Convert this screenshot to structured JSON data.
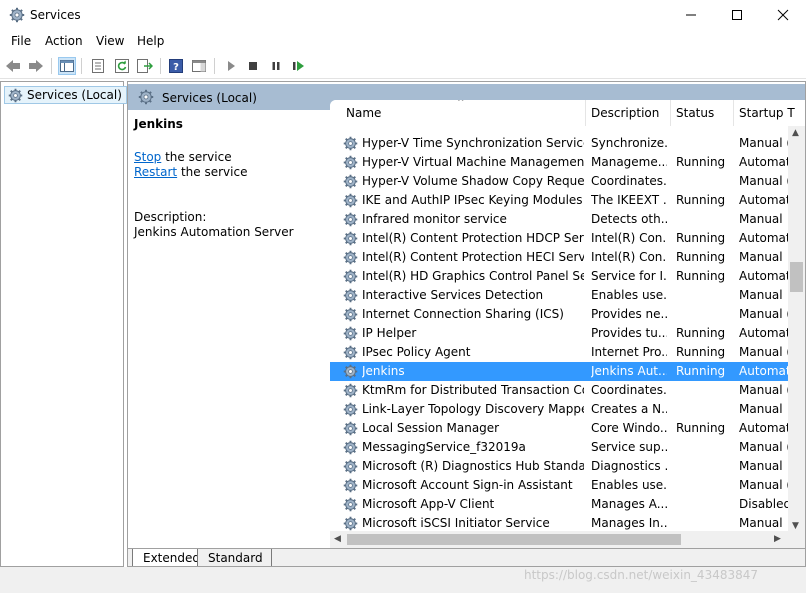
{
  "window": {
    "title": "Services"
  },
  "menu": [
    "File",
    "Action",
    "View",
    "Help"
  ],
  "tree": {
    "root_label": "Services (Local)"
  },
  "header": {
    "label": "Services (Local)"
  },
  "detail": {
    "service_name": "Jenkins",
    "stop_link": "Stop",
    "stop_rest": " the service",
    "restart_link": "Restart",
    "restart_rest": " the service",
    "description_label": "Description:",
    "description_text": "Jenkins Automation Server"
  },
  "columns": {
    "name": "Name",
    "description": "Description",
    "status": "Status",
    "startup": "Startup T"
  },
  "services": [
    {
      "name": "Hyper-V Time Synchronization Service",
      "description": "Synchronize...",
      "status": "",
      "startup": "Manual ("
    },
    {
      "name": "Hyper-V Virtual Machine Management",
      "description": "Manageme...",
      "status": "Running",
      "startup": "Automat"
    },
    {
      "name": "Hyper-V Volume Shadow Copy Requestor",
      "description": "Coordinates...",
      "status": "",
      "startup": "Manual ("
    },
    {
      "name": "IKE and AuthIP IPsec Keying Modules",
      "description": "The IKEEXT ...",
      "status": "Running",
      "startup": "Automat"
    },
    {
      "name": "Infrared monitor service",
      "description": "Detects oth...",
      "status": "",
      "startup": "Manual"
    },
    {
      "name": "Intel(R) Content Protection HDCP Service",
      "description": "Intel(R) Con...",
      "status": "Running",
      "startup": "Automat"
    },
    {
      "name": "Intel(R) Content Protection HECI Service",
      "description": "Intel(R) Con...",
      "status": "Running",
      "startup": "Manual"
    },
    {
      "name": "Intel(R) HD Graphics Control Panel Servi...",
      "description": "Service for I...",
      "status": "Running",
      "startup": "Automat"
    },
    {
      "name": "Interactive Services Detection",
      "description": "Enables use...",
      "status": "",
      "startup": "Manual"
    },
    {
      "name": "Internet Connection Sharing (ICS)",
      "description": "Provides ne...",
      "status": "",
      "startup": "Manual ("
    },
    {
      "name": "IP Helper",
      "description": "Provides tu...",
      "status": "Running",
      "startup": "Automat"
    },
    {
      "name": "IPsec Policy Agent",
      "description": "Internet Pro...",
      "status": "Running",
      "startup": "Manual ("
    },
    {
      "name": "Jenkins",
      "description": "Jenkins Aut...",
      "status": "Running",
      "startup": "Automat",
      "selected": true
    },
    {
      "name": "KtmRm for Distributed Transaction Coor...",
      "description": "Coordinates...",
      "status": "",
      "startup": "Manual ("
    },
    {
      "name": "Link-Layer Topology Discovery Mapper",
      "description": "Creates a N...",
      "status": "",
      "startup": "Manual"
    },
    {
      "name": "Local Session Manager",
      "description": "Core Windo...",
      "status": "Running",
      "startup": "Automat"
    },
    {
      "name": "MessagingService_f32019a",
      "description": "Service sup...",
      "status": "",
      "startup": "Manual ("
    },
    {
      "name": "Microsoft (R) Diagnostics Hub Standard ...",
      "description": "Diagnostics ...",
      "status": "",
      "startup": "Manual"
    },
    {
      "name": "Microsoft Account Sign-in Assistant",
      "description": "Enables use...",
      "status": "",
      "startup": "Manual ("
    },
    {
      "name": "Microsoft App-V Client",
      "description": "Manages A...",
      "status": "",
      "startup": "Disabled"
    },
    {
      "name": "Microsoft iSCSI Initiator Service",
      "description": "Manages In...",
      "status": "",
      "startup": "Manual"
    }
  ],
  "tabs": [
    "Extended",
    "Standard"
  ],
  "watermark": "https://blog.csdn.net/weixin_43483847",
  "colors": {
    "selection": "#3399ff",
    "header_band": "#a7bcd2",
    "link": "#0066cc"
  }
}
